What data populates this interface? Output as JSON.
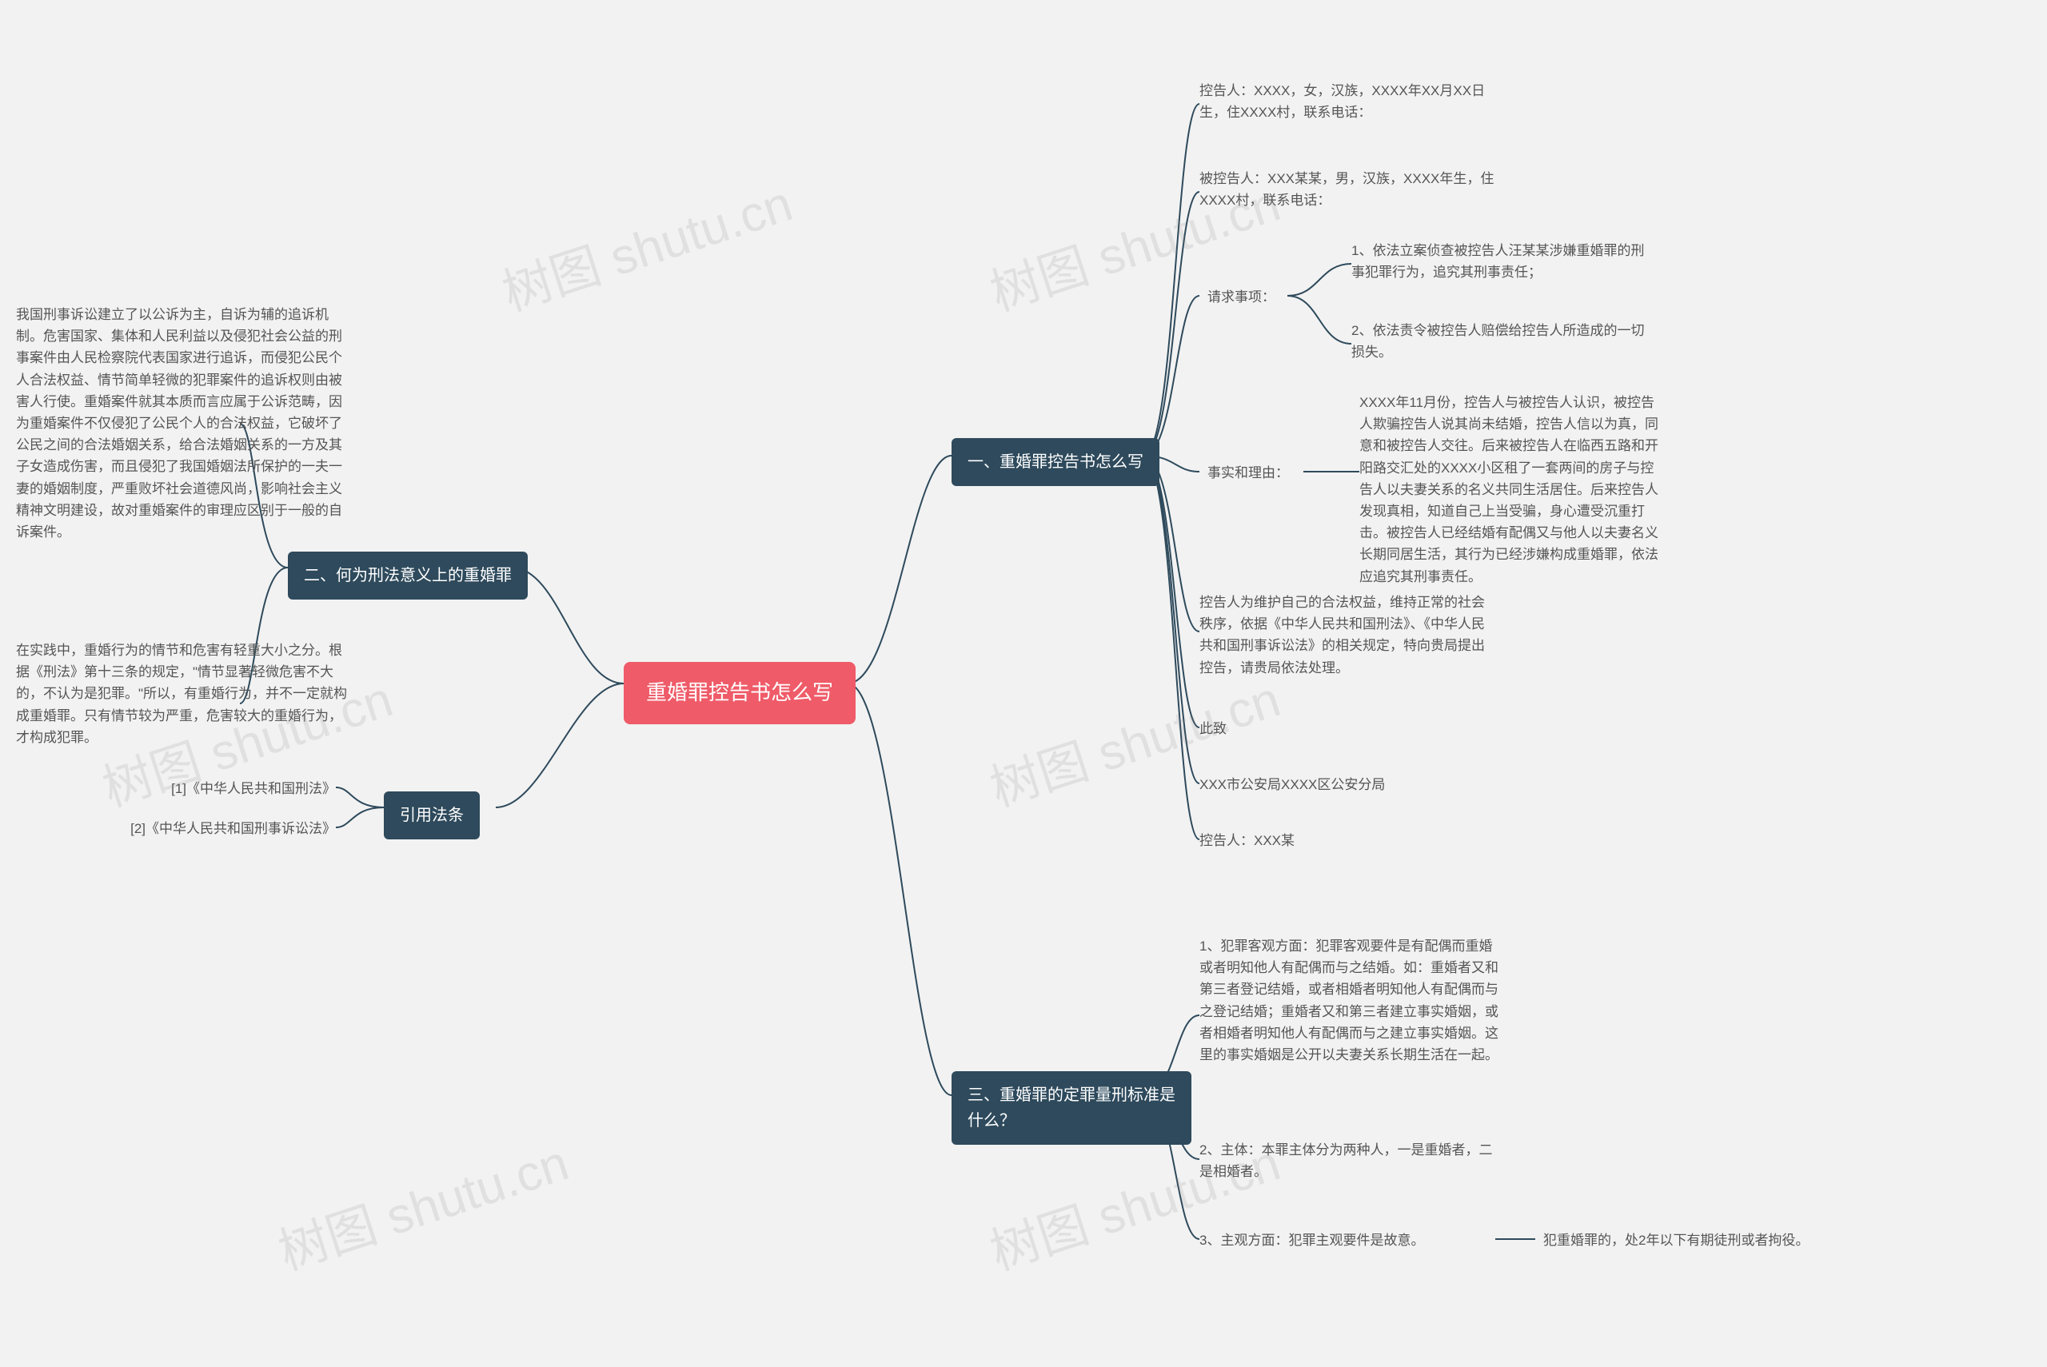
{
  "root": {
    "title": "重婚罪控告书怎么写"
  },
  "left": {
    "section2": {
      "title": "二、何为刑法意义上的重婚罪",
      "para1": "我国刑事诉讼建立了以公诉为主，自诉为辅的追诉机制。危害国家、集体和人民利益以及侵犯社会公益的刑事案件由人民检察院代表国家进行追诉，而侵犯公民个人合法权益、情节简单轻微的犯罪案件的追诉权则由被害人行使。重婚案件就其本质而言应属于公诉范畴，因为重婚案件不仅侵犯了公民个人的合法权益，它破坏了公民之间的合法婚姻关系，给合法婚姻关系的一方及其子女造成伤害，而且侵犯了我国婚姻法所保护的一夫一妻的婚姻制度，严重败坏社会道德风尚，影响社会主义精神文明建设，故对重婚案件的审理应区别于一般的自诉案件。",
      "para2": "在实践中，重婚行为的情节和危害有轻重大小之分。根据《刑法》第十三条的规定，\"情节显著轻微危害不大的，不认为是犯罪。\"所以，有重婚行为，并不一定就构成重婚罪。只有情节较为严重，危害较大的重婚行为，才构成犯罪。"
    },
    "references": {
      "title": "引用法条",
      "items": [
        "[1]《中华人民共和国刑法》",
        "[2]《中华人民共和国刑事诉讼法》"
      ]
    }
  },
  "right": {
    "section1": {
      "title": "一、重婚罪控告书怎么写",
      "plaintiff": "控告人：XXXX，女，汉族，XXXX年XX月XX日生，住XXXX村，联系电话：",
      "defendant": "被控告人：XXX某某，男，汉族，XXXX年生，住XXXX村，联系电话：",
      "request": {
        "label": "请求事项：",
        "items": [
          "1、依法立案侦查被控告人汪某某涉嫌重婚罪的刑事犯罪行为，追究其刑事责任；",
          "2、依法责令被控告人赔偿给控告人所造成的一切损失。"
        ]
      },
      "facts": {
        "label": "事实和理由：",
        "text": "XXXX年11月份，控告人与被控告人认识，被控告人欺骗控告人说其尚未结婚，控告人信以为真，同意和被控告人交往。后来被控告人在临西五路和开阳路交汇处的XXXX小区租了一套两间的房子与控告人以夫妻关系的名义共同生活居住。后来控告人发现真相，知道自己上当受骗，身心遭受沉重打击。被控告人已经结婚有配偶又与他人以夫妻名义长期同居生活，其行为已经涉嫌构成重婚罪，依法应追究其刑事责任。"
      },
      "closing": "控告人为维护自己的合法权益，维持正常的社会秩序，依据《中华人民共和国刑法》、《中华人民共和国刑事诉讼法》的相关规定，特向贵局提出控告，请贵局依法处理。",
      "cici": "此致",
      "bureau": "XXX市公安局XXXX区公安分局",
      "signer": "控告人：XXX某"
    },
    "section3": {
      "title": "三、重婚罪的定罪量刑标准是什么？",
      "items": [
        "1、犯罪客观方面：犯罪客观要件是有配偶而重婚或者明知他人有配偶而与之结婚。如：重婚者又和第三者登记结婚，或者相婚者明知他人有配偶而与之登记结婚；重婚者又和第三者建立事实婚姻，或者相婚者明知他人有配偶而与之建立事实婚姻。这里的事实婚姻是公开以夫妻关系长期生活在一起。",
        "2、主体：本罪主体分为两种人，一是重婚者，二是相婚者。",
        "3、主观方面：犯罪主观要件是故意。"
      ],
      "tail": "犯重婚罪的，处2年以下有期徒刑或者拘役。"
    }
  },
  "watermark": "树图 shutu.cn"
}
